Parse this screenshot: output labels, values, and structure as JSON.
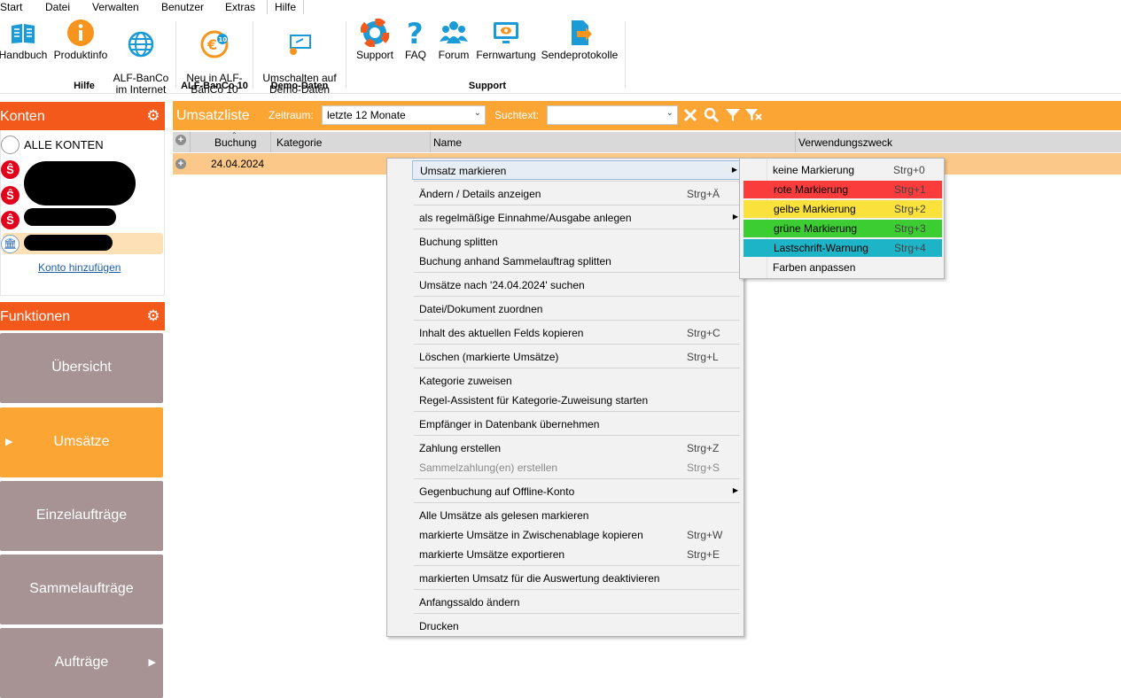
{
  "menubar": {
    "tabs": [
      "Start",
      "Datei",
      "Verwalten",
      "Benutzer",
      "Extras",
      "Hilfe"
    ]
  },
  "ribbon": {
    "buttons": [
      {
        "label": "Handbuch",
        "icon": "book-icon"
      },
      {
        "label": "Produktinfo",
        "icon": "info-icon"
      },
      {
        "label": "ALF-BanCo\nim Internet",
        "icon": "globe-icon"
      },
      {
        "label": "Neu in ALF-\nBanCo 10",
        "icon": "euro-10-icon"
      },
      {
        "label": "Umschalten auf\nDemo-Daten",
        "icon": "demo-switch-icon"
      },
      {
        "label": "Support",
        "icon": "lifebuoy-icon"
      },
      {
        "label": "FAQ",
        "icon": "question-icon"
      },
      {
        "label": "Forum",
        "icon": "users-icon"
      },
      {
        "label": "Fernwartung",
        "icon": "remote-monitor-icon"
      },
      {
        "label": "Sendeprotokolle",
        "icon": "send-log-icon"
      }
    ],
    "groups": [
      "Hilfe",
      "ALF-BanCo 10",
      "Demo-Daten",
      "Support"
    ]
  },
  "konten": {
    "title": "Konten",
    "all_accounts": "ALLE KONTEN",
    "add_account": "Konto hinzufügen"
  },
  "funktionen": {
    "title": "Funktionen",
    "items": [
      "Übersicht",
      "Umsätze",
      "Einzelaufträge",
      "Sammelaufträge",
      "Aufträge"
    ]
  },
  "umsatzliste": {
    "title": "Umsatzliste",
    "zeitraum_label": "Zeitraum:",
    "zeitraum_value": "letzte 12 Monate",
    "suchtext_label": "Suchtext:",
    "suchtext_value": ""
  },
  "table": {
    "columns": [
      "Buchung",
      "Kategorie",
      "Name",
      "Verwendungszweck"
    ],
    "rows": [
      {
        "buchung": "24.04.2024",
        "kategorie": "",
        "name": "",
        "verwendungszweck": ""
      }
    ]
  },
  "context_menu": {
    "items": [
      {
        "label": "Umsatz markieren",
        "shortcut": "",
        "submenu": true
      },
      {
        "label": "Ändern / Details anzeigen",
        "shortcut": "Strg+Ä"
      },
      {
        "label": "als regelmäßige Einnahme/Ausgabe anlegen",
        "shortcut": "",
        "submenu": true
      },
      {
        "label": "Buchung splitten",
        "shortcut": ""
      },
      {
        "label": "Buchung anhand Sammelauftrag splitten",
        "shortcut": ""
      },
      {
        "label": "Umsätze nach '24.04.2024' suchen",
        "shortcut": ""
      },
      {
        "label": "Datei/Dokument zuordnen",
        "shortcut": ""
      },
      {
        "label": "Inhalt des aktuellen Felds kopieren",
        "shortcut": "Strg+C"
      },
      {
        "label": "Löschen (markierte Umsätze)",
        "shortcut": "Strg+L"
      },
      {
        "label": "Kategorie zuweisen",
        "shortcut": ""
      },
      {
        "label": "Regel-Assistent für Kategorie-Zuweisung starten",
        "shortcut": ""
      },
      {
        "label": "Empfänger in Datenbank übernehmen",
        "shortcut": ""
      },
      {
        "label": "Zahlung erstellen",
        "shortcut": "Strg+Z"
      },
      {
        "label": "Sammelzahlung(en) erstellen",
        "shortcut": "Strg+S",
        "disabled": true
      },
      {
        "label": "Gegenbuchung auf Offline-Konto",
        "shortcut": "",
        "submenu": true
      },
      {
        "label": "Alle Umsätze als gelesen markieren",
        "shortcut": ""
      },
      {
        "label": "markierte Umsätze in Zwischenablage kopieren",
        "shortcut": "Strg+W"
      },
      {
        "label": "markierte Umsätze exportieren",
        "shortcut": "Strg+E"
      },
      {
        "label": "markierten Umsatz für die Auswertung deaktivieren",
        "shortcut": ""
      },
      {
        "label": "Anfangssaldo ändern",
        "shortcut": ""
      },
      {
        "label": "Drucken",
        "shortcut": ""
      }
    ]
  },
  "submenu": {
    "items": [
      {
        "label": "keine Markierung",
        "shortcut": "Strg+0",
        "color": "#f2f2f2"
      },
      {
        "label": "rote Markierung",
        "shortcut": "Strg+1",
        "color": "#fa3c3c"
      },
      {
        "label": "gelbe Markierung",
        "shortcut": "Strg+2",
        "color": "#fae13c"
      },
      {
        "label": "grüne Markierung",
        "shortcut": "Strg+3",
        "color": "#3ccd32"
      },
      {
        "label": "Lastschrift-Warnung",
        "shortcut": "Strg+4",
        "color": "#1eb4c8"
      },
      {
        "label": "Farben anpassen",
        "shortcut": ""
      }
    ]
  },
  "colors": {
    "brand_orange": "#f4591c",
    "header_orange": "#fba535",
    "row_highlight": "#fcc88a",
    "function_button": "#a79393"
  }
}
